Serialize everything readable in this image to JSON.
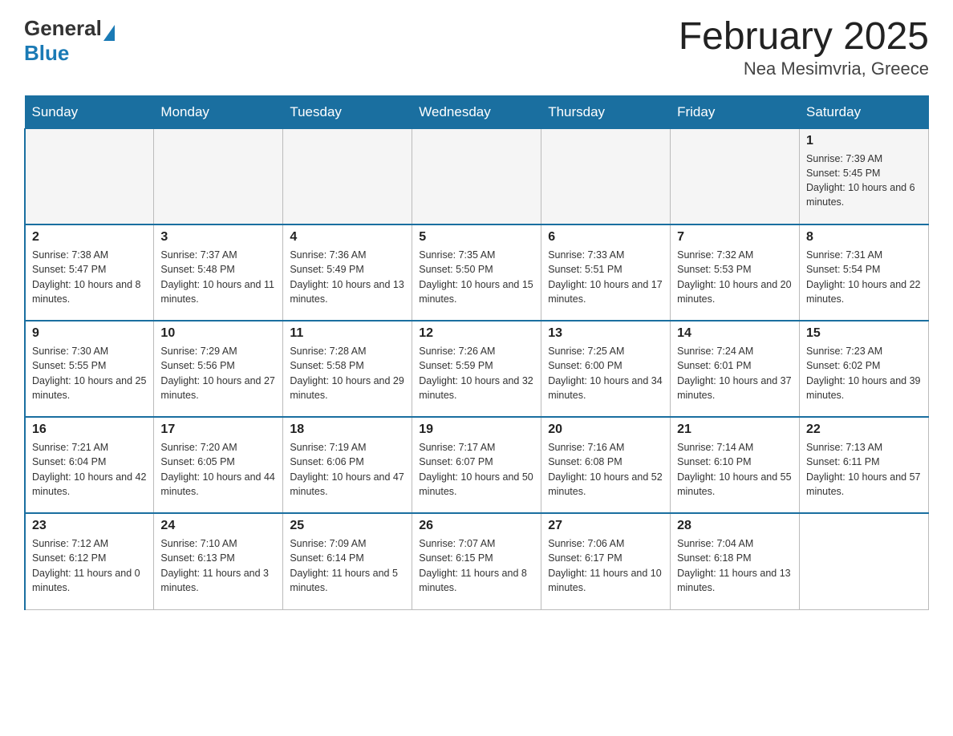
{
  "header": {
    "logo_general": "General",
    "logo_blue": "Blue",
    "title": "February 2025",
    "subtitle": "Nea Mesimvria, Greece"
  },
  "days_of_week": [
    "Sunday",
    "Monday",
    "Tuesday",
    "Wednesday",
    "Thursday",
    "Friday",
    "Saturday"
  ],
  "weeks": [
    [
      {
        "day": "",
        "info": ""
      },
      {
        "day": "",
        "info": ""
      },
      {
        "day": "",
        "info": ""
      },
      {
        "day": "",
        "info": ""
      },
      {
        "day": "",
        "info": ""
      },
      {
        "day": "",
        "info": ""
      },
      {
        "day": "1",
        "info": "Sunrise: 7:39 AM\nSunset: 5:45 PM\nDaylight: 10 hours and 6 minutes."
      }
    ],
    [
      {
        "day": "2",
        "info": "Sunrise: 7:38 AM\nSunset: 5:47 PM\nDaylight: 10 hours and 8 minutes."
      },
      {
        "day": "3",
        "info": "Sunrise: 7:37 AM\nSunset: 5:48 PM\nDaylight: 10 hours and 11 minutes."
      },
      {
        "day": "4",
        "info": "Sunrise: 7:36 AM\nSunset: 5:49 PM\nDaylight: 10 hours and 13 minutes."
      },
      {
        "day": "5",
        "info": "Sunrise: 7:35 AM\nSunset: 5:50 PM\nDaylight: 10 hours and 15 minutes."
      },
      {
        "day": "6",
        "info": "Sunrise: 7:33 AM\nSunset: 5:51 PM\nDaylight: 10 hours and 17 minutes."
      },
      {
        "day": "7",
        "info": "Sunrise: 7:32 AM\nSunset: 5:53 PM\nDaylight: 10 hours and 20 minutes."
      },
      {
        "day": "8",
        "info": "Sunrise: 7:31 AM\nSunset: 5:54 PM\nDaylight: 10 hours and 22 minutes."
      }
    ],
    [
      {
        "day": "9",
        "info": "Sunrise: 7:30 AM\nSunset: 5:55 PM\nDaylight: 10 hours and 25 minutes."
      },
      {
        "day": "10",
        "info": "Sunrise: 7:29 AM\nSunset: 5:56 PM\nDaylight: 10 hours and 27 minutes."
      },
      {
        "day": "11",
        "info": "Sunrise: 7:28 AM\nSunset: 5:58 PM\nDaylight: 10 hours and 29 minutes."
      },
      {
        "day": "12",
        "info": "Sunrise: 7:26 AM\nSunset: 5:59 PM\nDaylight: 10 hours and 32 minutes."
      },
      {
        "day": "13",
        "info": "Sunrise: 7:25 AM\nSunset: 6:00 PM\nDaylight: 10 hours and 34 minutes."
      },
      {
        "day": "14",
        "info": "Sunrise: 7:24 AM\nSunset: 6:01 PM\nDaylight: 10 hours and 37 minutes."
      },
      {
        "day": "15",
        "info": "Sunrise: 7:23 AM\nSunset: 6:02 PM\nDaylight: 10 hours and 39 minutes."
      }
    ],
    [
      {
        "day": "16",
        "info": "Sunrise: 7:21 AM\nSunset: 6:04 PM\nDaylight: 10 hours and 42 minutes."
      },
      {
        "day": "17",
        "info": "Sunrise: 7:20 AM\nSunset: 6:05 PM\nDaylight: 10 hours and 44 minutes."
      },
      {
        "day": "18",
        "info": "Sunrise: 7:19 AM\nSunset: 6:06 PM\nDaylight: 10 hours and 47 minutes."
      },
      {
        "day": "19",
        "info": "Sunrise: 7:17 AM\nSunset: 6:07 PM\nDaylight: 10 hours and 50 minutes."
      },
      {
        "day": "20",
        "info": "Sunrise: 7:16 AM\nSunset: 6:08 PM\nDaylight: 10 hours and 52 minutes."
      },
      {
        "day": "21",
        "info": "Sunrise: 7:14 AM\nSunset: 6:10 PM\nDaylight: 10 hours and 55 minutes."
      },
      {
        "day": "22",
        "info": "Sunrise: 7:13 AM\nSunset: 6:11 PM\nDaylight: 10 hours and 57 minutes."
      }
    ],
    [
      {
        "day": "23",
        "info": "Sunrise: 7:12 AM\nSunset: 6:12 PM\nDaylight: 11 hours and 0 minutes."
      },
      {
        "day": "24",
        "info": "Sunrise: 7:10 AM\nSunset: 6:13 PM\nDaylight: 11 hours and 3 minutes."
      },
      {
        "day": "25",
        "info": "Sunrise: 7:09 AM\nSunset: 6:14 PM\nDaylight: 11 hours and 5 minutes."
      },
      {
        "day": "26",
        "info": "Sunrise: 7:07 AM\nSunset: 6:15 PM\nDaylight: 11 hours and 8 minutes."
      },
      {
        "day": "27",
        "info": "Sunrise: 7:06 AM\nSunset: 6:17 PM\nDaylight: 11 hours and 10 minutes."
      },
      {
        "day": "28",
        "info": "Sunrise: 7:04 AM\nSunset: 6:18 PM\nDaylight: 11 hours and 13 minutes."
      },
      {
        "day": "",
        "info": ""
      }
    ]
  ]
}
